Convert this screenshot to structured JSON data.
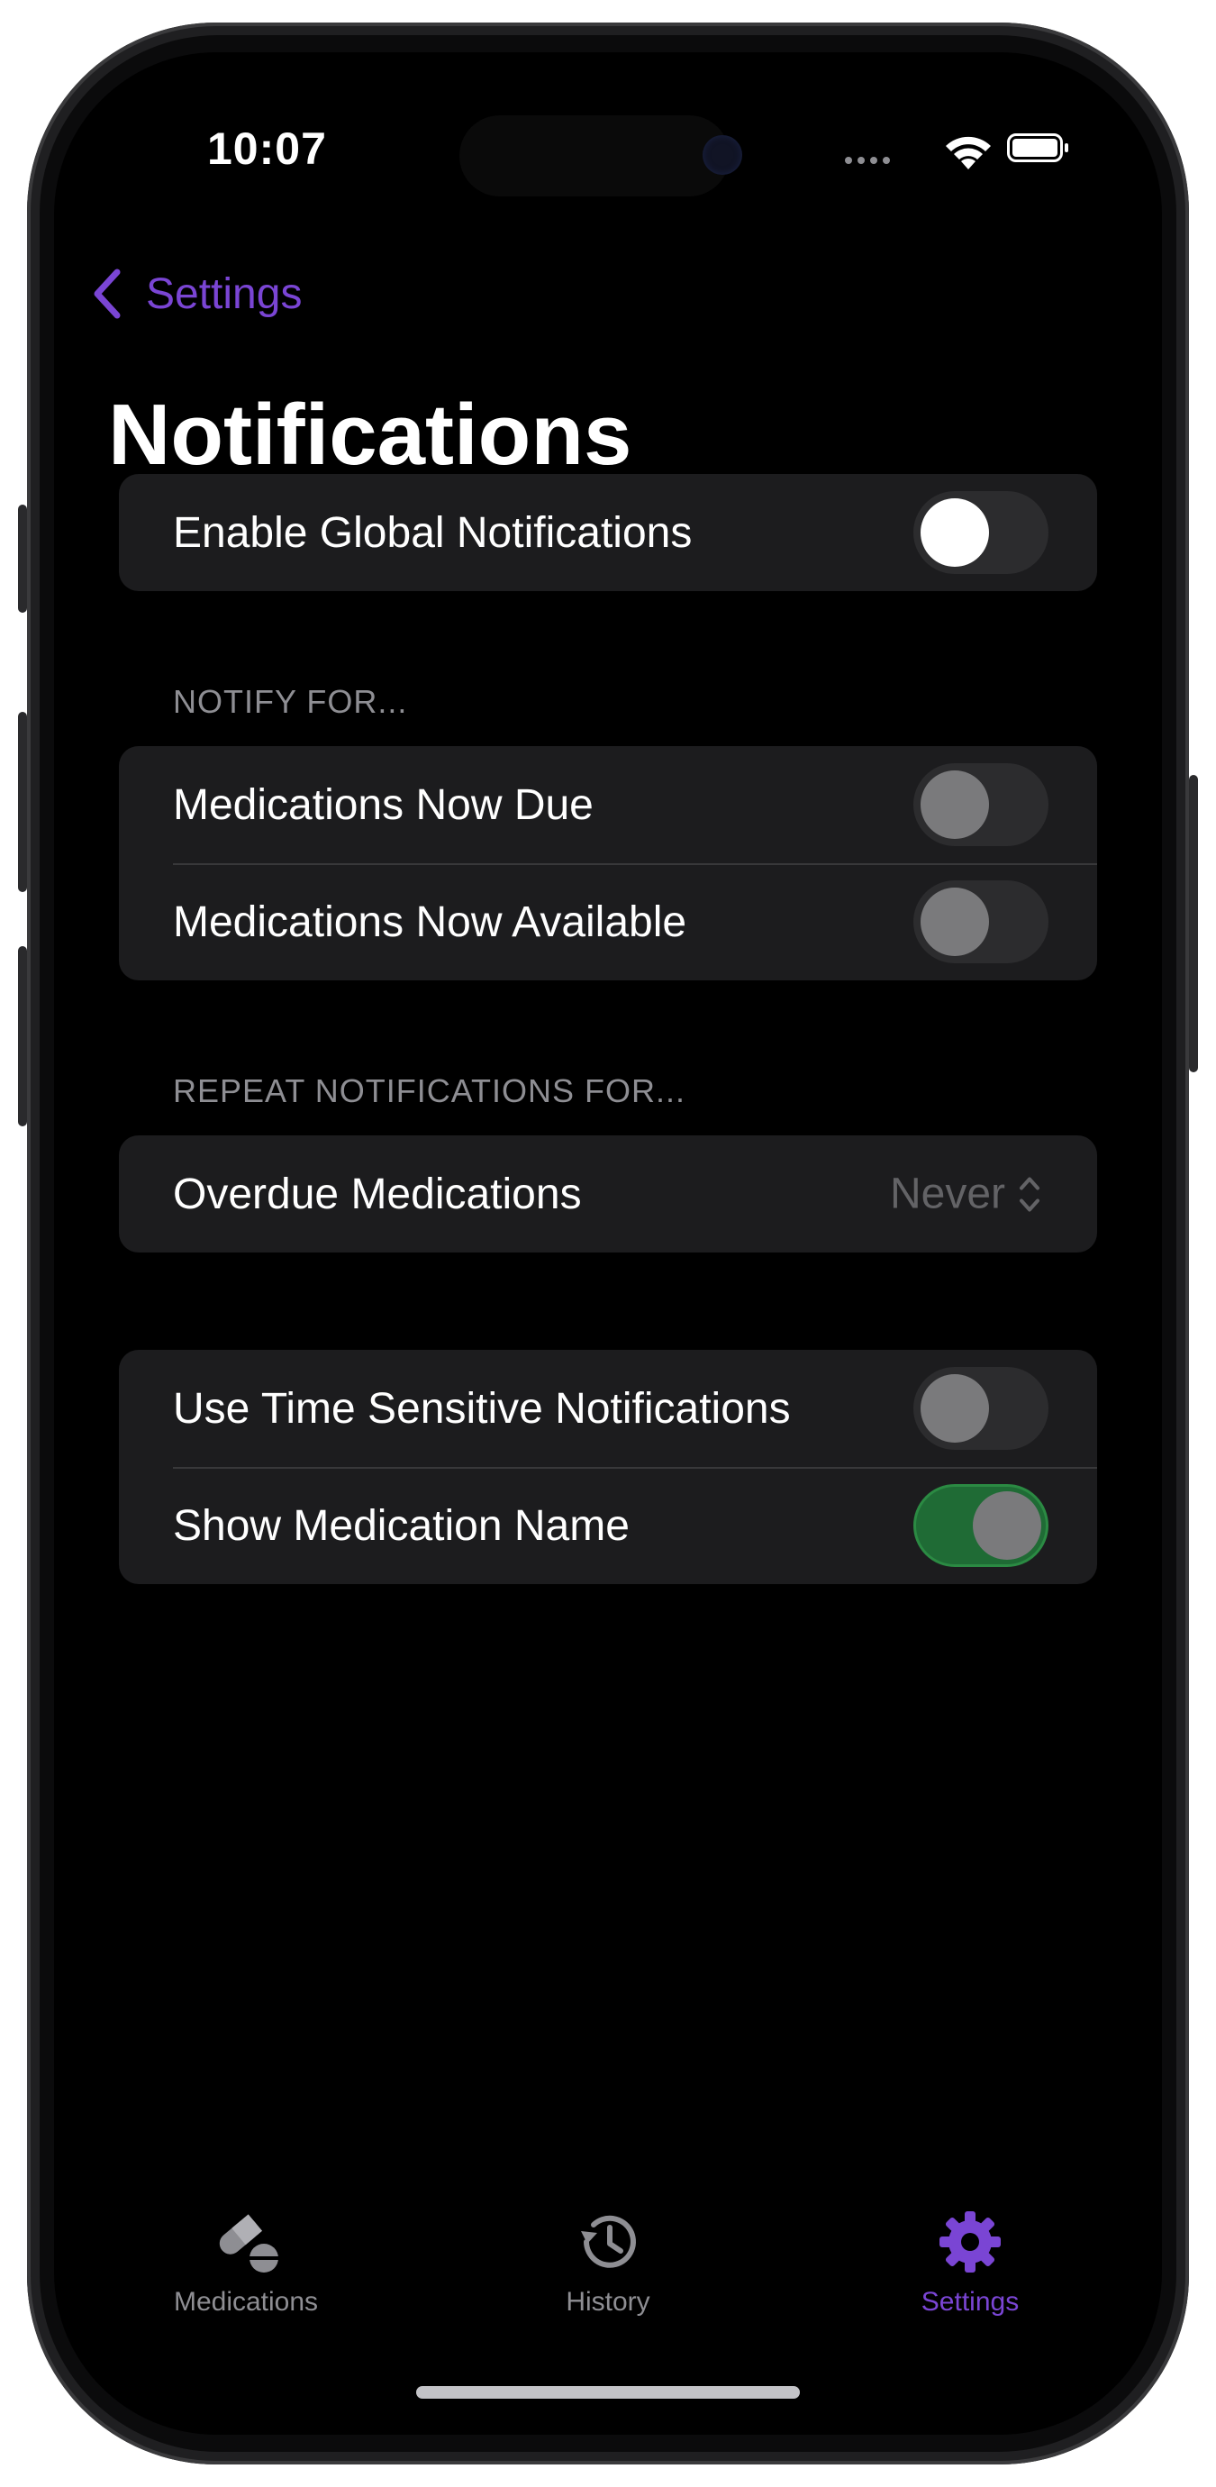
{
  "status_bar": {
    "time": "10:07"
  },
  "nav": {
    "back_label": "Settings",
    "title": "Notifications"
  },
  "global": {
    "label": "Enable Global Notifications",
    "enabled": false
  },
  "notify_for": {
    "header": "NOTIFY FOR...",
    "items": [
      {
        "label": "Medications Now Due",
        "enabled": false
      },
      {
        "label": "Medications Now Available",
        "enabled": false
      }
    ]
  },
  "repeat": {
    "header": "REPEAT NOTIFICATIONS FOR...",
    "items": [
      {
        "label": "Overdue Medications",
        "value": "Never"
      }
    ]
  },
  "options": {
    "items": [
      {
        "label": "Use Time Sensitive Notifications",
        "enabled": false
      },
      {
        "label": "Show Medication Name",
        "enabled": true
      }
    ]
  },
  "tabbar": {
    "tabs": [
      {
        "label": "Medications",
        "icon": "pills-icon",
        "active": false
      },
      {
        "label": "History",
        "icon": "history-icon",
        "active": false
      },
      {
        "label": "Settings",
        "icon": "gear-icon",
        "active": true
      }
    ]
  },
  "colors": {
    "accent": "#7a45d4",
    "toggle_on": "#1f6b35",
    "background": "#000000",
    "cell": "#1c1c1e"
  }
}
